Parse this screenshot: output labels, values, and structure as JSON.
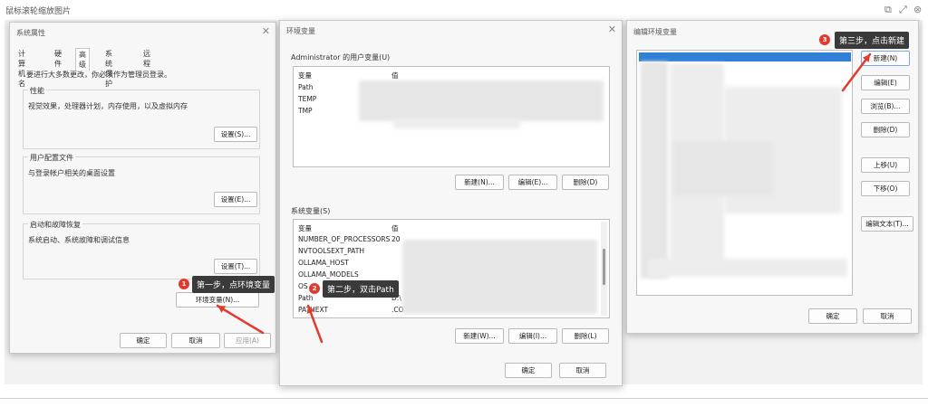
{
  "viewer": {
    "title": "鼠标滚轮缩放图片",
    "icons": [
      "open-external-icon",
      "expand-icon",
      "close-icon"
    ]
  },
  "sysprops": {
    "title": "系统属性",
    "tabs": [
      "计算机名",
      "硬件",
      "高级",
      "系统保护",
      "远程"
    ],
    "active_tab": "高级",
    "admin_note": "要进行大多数更改，你必须作为管理员登录。",
    "perf": {
      "label": "性能",
      "desc": "视觉效果，处理器计划，内存使用，以及虚拟内存",
      "button": "设置(S)..."
    },
    "profile": {
      "label": "用户配置文件",
      "desc": "与登录帐户相关的桌面设置",
      "button": "设置(E)..."
    },
    "startup": {
      "label": "启动和故障恢复",
      "desc": "系统启动、系统故障和调试信息",
      "button": "设置(T)..."
    },
    "env_button": "环境变量(N)...",
    "ok": "确定",
    "cancel": "取消",
    "apply": "应用(A)"
  },
  "envvars": {
    "title": "环境变量",
    "user_section": "Administrator 的用户变量(U)",
    "col_var": "变量",
    "col_val": "值",
    "user_rows": [
      "Path",
      "TEMP",
      "TMP"
    ],
    "user_buttons": [
      "新建(N)...",
      "编辑(E)...",
      "删除(D)"
    ],
    "sys_section": "系统变量(S)",
    "sys_rows": [
      {
        "name": "NUMBER_OF_PROCESSORS",
        "value": "20"
      },
      {
        "name": "NVTOOLSEXT_PATH",
        "value": ""
      },
      {
        "name": "OLLAMA_HOST",
        "value": ""
      },
      {
        "name": "OLLAMA_MODELS",
        "value": ""
      },
      {
        "name": "OS",
        "value": ""
      },
      {
        "name": "Path",
        "value": "D:\\"
      },
      {
        "name": "PATHEXT",
        "value": ".CO"
      }
    ],
    "sys_buttons": [
      "新建(W)...",
      "编辑(I)...",
      "删除(L)"
    ],
    "ok": "确定",
    "cancel": "取消"
  },
  "editenv": {
    "title": "编辑环境变量",
    "buttons": [
      "新建(N)",
      "编辑(E)",
      "浏览(B)...",
      "删除(D)",
      "上移(U)",
      "下移(O)",
      "编辑文本(T)..."
    ],
    "ok": "确定",
    "cancel": "取消"
  },
  "annotations": {
    "step1": {
      "num": "1",
      "text": "第一步，点环境变量"
    },
    "step2": {
      "num": "2",
      "text": "第二步，双击Path"
    },
    "step3": {
      "num": "3",
      "text": "第三步，点击新建"
    },
    "color": "#e23b2e"
  }
}
